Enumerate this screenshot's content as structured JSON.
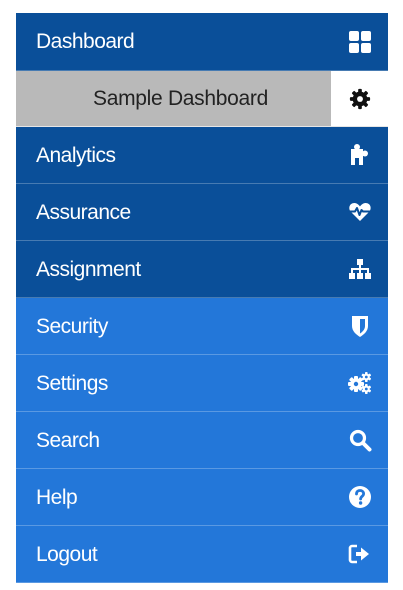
{
  "menu": {
    "header": {
      "label": "Dashboard",
      "icon": "grid-icon"
    },
    "submenu": {
      "label": "Sample Dashboard",
      "icon": "gear-icon"
    },
    "items": [
      {
        "label": "Analytics",
        "icon": "puzzle-icon"
      },
      {
        "label": "Assurance",
        "icon": "heartbeat-icon"
      },
      {
        "label": "Assignment",
        "icon": "sitemap-icon"
      },
      {
        "label": "Security",
        "icon": "shield-icon"
      },
      {
        "label": "Settings",
        "icon": "cogs-icon"
      },
      {
        "label": "Search",
        "icon": "search-icon"
      },
      {
        "label": "Help",
        "icon": "question-circle-icon"
      },
      {
        "label": "Logout",
        "icon": "sign-out-icon"
      }
    ]
  },
  "colors": {
    "dark_blue": "#0a4f99",
    "light_blue": "#2377d9",
    "submenu_gray": "#b9b9b9"
  }
}
